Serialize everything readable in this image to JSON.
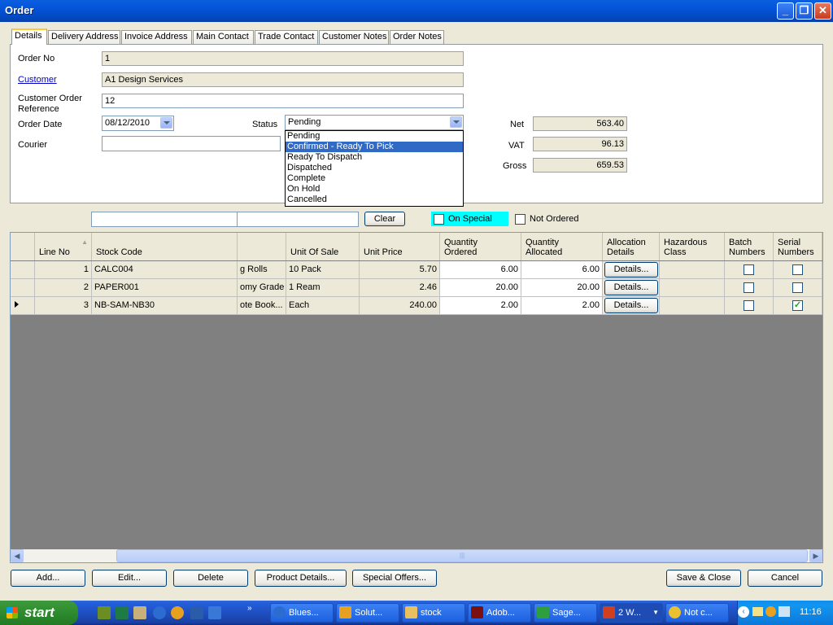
{
  "window": {
    "title": "Order"
  },
  "tabs": [
    "Details",
    "Delivery Address",
    "Invoice Address",
    "Main Contact",
    "Trade Contact",
    "Customer Notes",
    "Order Notes"
  ],
  "details": {
    "order_no_label": "Order No",
    "order_no": "1",
    "customer_label": "Customer",
    "customer": "A1 Design Services",
    "customer_order_ref_label": "Customer Order Reference",
    "customer_order_ref": "12",
    "order_date_label": "Order Date",
    "order_date": "08/12/2010",
    "status_label": "Status",
    "status": "Pending",
    "status_options": [
      "Pending",
      "Confirmed - Ready To Pick",
      "Ready To Dispatch",
      "Dispatched",
      "Complete",
      "On Hold",
      "Cancelled"
    ],
    "status_highlighted": "Confirmed - Ready To Pick",
    "courier_label": "Courier",
    "courier": "",
    "net_label": "Net",
    "net": "563.40",
    "vat_label": "VAT",
    "vat": "96.13",
    "gross_label": "Gross",
    "gross": "659.53"
  },
  "filter": {
    "search1": "",
    "search2": "",
    "clear_label": "Clear",
    "on_special_label": "On Special",
    "not_ordered_label": "Not Ordered",
    "on_special_color": "#00FFFF"
  },
  "grid": {
    "columns": [
      "Line No",
      "Stock Code",
      "",
      "Unit Of Sale",
      "Unit Price",
      "Quantity Ordered",
      "Quantity Allocated",
      "Allocation Details",
      "Hazardous Class",
      "Batch Numbers",
      "Serial Numbers"
    ],
    "rows": [
      {
        "line_no": "1",
        "stock_code": "CALC004",
        "description": "g Rolls",
        "unit_of_sale": "10 Pack",
        "unit_price": "5.70",
        "qty_ordered": "6.00",
        "qty_allocated": "6.00",
        "details": "Details...",
        "hazardous": "",
        "batch": false,
        "serial": false
      },
      {
        "line_no": "2",
        "stock_code": "PAPER001",
        "description": "omy Grade",
        "unit_of_sale": "1 Ream",
        "unit_price": "2.46",
        "qty_ordered": "20.00",
        "qty_allocated": "20.00",
        "details": "Details...",
        "hazardous": "",
        "batch": false,
        "serial": false
      },
      {
        "line_no": "3",
        "stock_code": "NB-SAM-NB30",
        "description": "ote Book...",
        "unit_of_sale": "Each",
        "unit_price": "240.00",
        "qty_ordered": "2.00",
        "qty_allocated": "2.00",
        "details": "Details...",
        "hazardous": "",
        "batch": false,
        "serial": true
      }
    ]
  },
  "buttons": {
    "add": "Add...",
    "edit": "Edit...",
    "delete": "Delete",
    "product_details": "Product Details...",
    "special_offers": "Special Offers...",
    "save_close": "Save & Close",
    "cancel": "Cancel"
  },
  "taskbar": {
    "start": "start",
    "tasks": [
      "Blues...",
      "Solut...",
      "stock",
      "Adob...",
      "Sage...",
      "2 W...",
      "Not c..."
    ],
    "clock": "11:16"
  }
}
